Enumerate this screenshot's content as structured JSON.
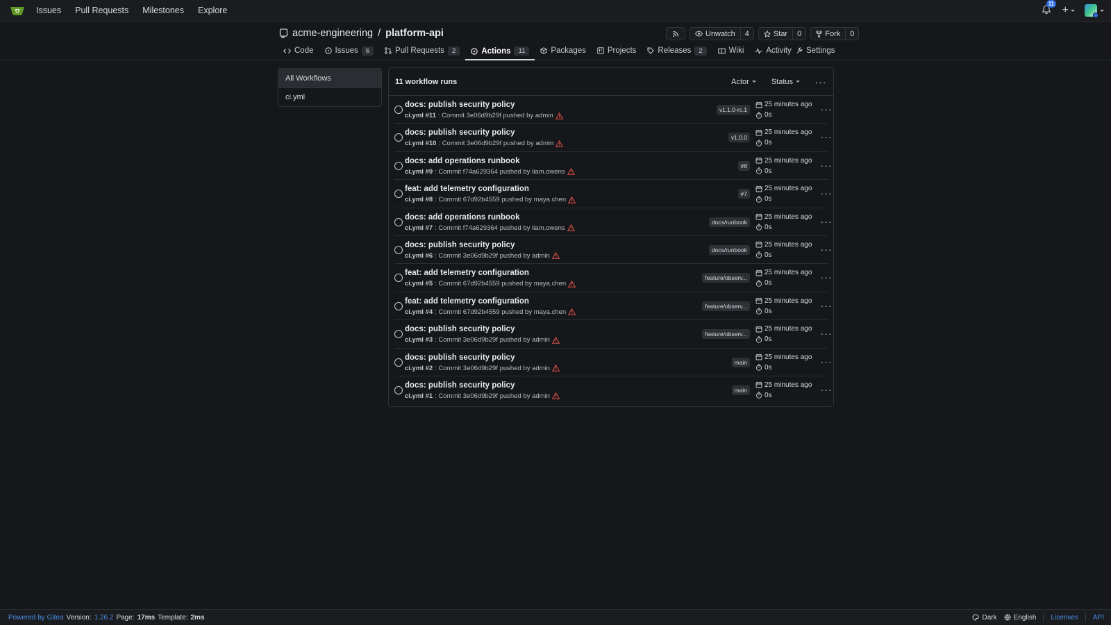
{
  "colors": {
    "accent": "#2f6fde",
    "link": "#4a8fe7",
    "warning": "#e5534b",
    "background": "#15171a"
  },
  "navbar": {
    "items": [
      "Issues",
      "Pull Requests",
      "Milestones",
      "Explore"
    ],
    "notification_count": "11"
  },
  "repo": {
    "owner": "acme-engineering",
    "separator": "/",
    "name": "platform-api",
    "unwatch_label": "Unwatch",
    "watch_count": "4",
    "star_label": "Star",
    "star_count": "0",
    "fork_label": "Fork",
    "fork_count": "0"
  },
  "tabs": [
    {
      "label": "Code",
      "badge": ""
    },
    {
      "label": "Issues",
      "badge": "6"
    },
    {
      "label": "Pull Requests",
      "badge": "2"
    },
    {
      "label": "Actions",
      "badge": "11"
    },
    {
      "label": "Packages",
      "badge": ""
    },
    {
      "label": "Projects",
      "badge": ""
    },
    {
      "label": "Releases",
      "badge": "2"
    },
    {
      "label": "Wiki",
      "badge": ""
    },
    {
      "label": "Activity",
      "badge": ""
    }
  ],
  "settings_label": "Settings",
  "sidebar": {
    "items": [
      "All Workflows",
      "ci.yml"
    ]
  },
  "runs": {
    "count_label": "11 workflow runs",
    "actor_filter": "Actor",
    "status_filter": "Status",
    "items": [
      {
        "title": "docs: publish security policy",
        "run": "ci.yml #11",
        "meta": ": Commit 3e06d9b29f pushed by admin",
        "ref": "v1.1.0-rc.1",
        "time": "25 minutes ago",
        "duration": "0s"
      },
      {
        "title": "docs: publish security policy",
        "run": "ci.yml #10",
        "meta": ": Commit 3e06d9b29f pushed by admin",
        "ref": "v1.0.0",
        "time": "25 minutes ago",
        "duration": "0s"
      },
      {
        "title": "docs: add operations runbook",
        "run": "ci.yml #9",
        "meta": ": Commit f74a629364 pushed by liam.owens",
        "ref": "#8",
        "time": "25 minutes ago",
        "duration": "0s"
      },
      {
        "title": "feat: add telemetry configuration",
        "run": "ci.yml #8",
        "meta": ": Commit 67d92b4559 pushed by maya.chen",
        "ref": "#7",
        "time": "25 minutes ago",
        "duration": "0s"
      },
      {
        "title": "docs: add operations runbook",
        "run": "ci.yml #7",
        "meta": ": Commit f74a629364 pushed by liam.owens",
        "ref": "docs/runbook",
        "time": "25 minutes ago",
        "duration": "0s"
      },
      {
        "title": "docs: publish security policy",
        "run": "ci.yml #6",
        "meta": ": Commit 3e06d9b29f pushed by admin",
        "ref": "docs/runbook",
        "time": "25 minutes ago",
        "duration": "0s"
      },
      {
        "title": "feat: add telemetry configuration",
        "run": "ci.yml #5",
        "meta": ": Commit 67d92b4559 pushed by maya.chen",
        "ref": "feature/observ...",
        "time": "25 minutes ago",
        "duration": "0s"
      },
      {
        "title": "feat: add telemetry configuration",
        "run": "ci.yml #4",
        "meta": ": Commit 67d92b4559 pushed by maya.chen",
        "ref": "feature/observ...",
        "time": "25 minutes ago",
        "duration": "0s"
      },
      {
        "title": "docs: publish security policy",
        "run": "ci.yml #3",
        "meta": ": Commit 3e06d9b29f pushed by admin",
        "ref": "feature/observ...",
        "time": "25 minutes ago",
        "duration": "0s"
      },
      {
        "title": "docs: publish security policy",
        "run": "ci.yml #2",
        "meta": ": Commit 3e06d9b29f pushed by admin",
        "ref": "main",
        "time": "25 minutes ago",
        "duration": "0s"
      },
      {
        "title": "docs: publish security policy",
        "run": "ci.yml #1",
        "meta": ": Commit 3e06d9b29f pushed by admin",
        "ref": "main",
        "time": "25 minutes ago",
        "duration": "0s"
      }
    ]
  },
  "footer": {
    "powered_by": "Powered by Gitea",
    "version_label": "Version:",
    "version": "1.26.2",
    "page_label": "Page:",
    "page_time": "17ms",
    "template_label": "Template:",
    "template_time": "2ms",
    "theme": "Dark",
    "language": "English",
    "licenses": "Licenses",
    "api": "API"
  }
}
